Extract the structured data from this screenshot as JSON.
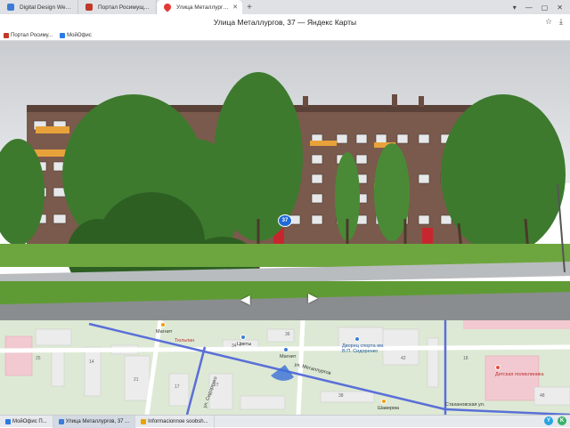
{
  "tabs": [
    {
      "label": "Digital Design Web Client",
      "favicon": "#3c7bd4"
    },
    {
      "label": "Портал Росимущества",
      "favicon": "#c0392b"
    },
    {
      "label": "Улица Металлургов, 37 ...",
      "favicon": "#e53935"
    }
  ],
  "window": {
    "title": "Улица Металлургов, 37 — Яндекс Карты"
  },
  "bookmarks": [
    {
      "label": "Портал Росиму...",
      "color": "#c0392b"
    },
    {
      "label": "МойОфис",
      "color": "#2a7be4"
    }
  ],
  "panorama": {
    "house_number": "37"
  },
  "minimap": {
    "labels": [
      {
        "text": "Магнит",
        "cls": ""
      },
      {
        "text": "Цветы",
        "cls": ""
      },
      {
        "text": "Магнит",
        "cls": ""
      },
      {
        "text": "Дворец спорта им. В.П. Сидоренко",
        "cls": "blue"
      },
      {
        "text": "Шаверма",
        "cls": ""
      },
      {
        "text": "Детская поликлиника",
        "cls": "red"
      },
      {
        "text": "ул. Металлургов",
        "cls": ""
      },
      {
        "text": "Стахановская ул.",
        "cls": ""
      },
      {
        "text": "ул. Сидоренко",
        "cls": ""
      },
      {
        "text": "Тюльпан",
        "cls": "red"
      }
    ],
    "numbers": [
      "25",
      "14",
      "21",
      "34",
      "36",
      "42",
      "38",
      "17",
      "27",
      "18",
      "48"
    ]
  },
  "taskbar": {
    "items": [
      {
        "label": "МойОфис П...",
        "color": "#2a7be4"
      },
      {
        "label": "Улица Металлургов, 37 ...",
        "color": "#3b7dd8"
      },
      {
        "label": "Informacionnoe soobsh...",
        "color": "#e9a400"
      }
    ]
  }
}
